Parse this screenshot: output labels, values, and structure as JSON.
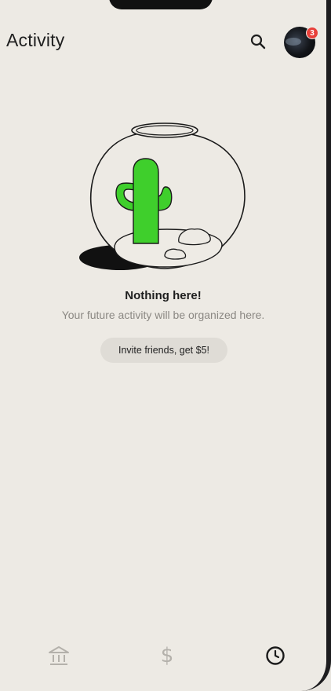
{
  "header": {
    "title": "Activity",
    "notification_count": "3"
  },
  "icons": {
    "search": "search-icon",
    "avatar": "avatar",
    "illustration": "cactus-fishbowl-illustration",
    "tabs": [
      "bank-icon",
      "dollar-icon",
      "clock-icon"
    ]
  },
  "empty_state": {
    "title": "Nothing here!",
    "subtitle": "Your future activity will be organized here.",
    "button_label": "Invite friends, get $5!"
  },
  "tabbar": {
    "dollar_glyph": "$",
    "active_tab": "activity"
  },
  "colors": {
    "background": "#edeae4",
    "cactus": "#3fcf2c",
    "badge": "#e8403a",
    "button_bg": "#dfdcd6",
    "subtitle_text": "#8b8883"
  }
}
